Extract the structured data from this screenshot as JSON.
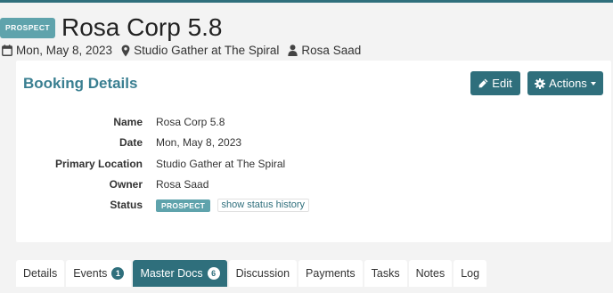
{
  "header": {
    "status_badge": "PROSPECT",
    "title": "Rosa Corp 5.8"
  },
  "meta": {
    "date": "Mon, May 8, 2023",
    "location": "Studio Gather at The Spiral",
    "owner": "Rosa Saad"
  },
  "card": {
    "title": "Booking Details",
    "edit_label": "Edit",
    "actions_label": "Actions"
  },
  "details": [
    {
      "label": "Name",
      "value": "Rosa Corp 5.8"
    },
    {
      "label": "Date",
      "value": "Mon, May 8, 2023"
    },
    {
      "label": "Primary Location",
      "value": "Studio Gather at The Spiral"
    },
    {
      "label": "Owner",
      "value": "Rosa Saad"
    }
  ],
  "status": {
    "label": "Status",
    "badge": "PROSPECT",
    "history_link": "show status history"
  },
  "tabs": [
    {
      "label": "Details"
    },
    {
      "label": "Events",
      "count": "1"
    },
    {
      "label": "Master Docs",
      "count": "6"
    },
    {
      "label": "Discussion"
    },
    {
      "label": "Payments"
    },
    {
      "label": "Tasks"
    },
    {
      "label": "Notes"
    },
    {
      "label": "Log"
    }
  ],
  "active_tab": "Master Docs",
  "colors": {
    "accent": "#2f6f7c",
    "badge": "#5fa3ac",
    "title": "#3a7f91",
    "background": "#f3f3f3"
  },
  "icons": {
    "date": "calendar-icon",
    "location": "map-marker-icon",
    "owner": "user-icon",
    "edit": "pencil-icon",
    "actions": "gear-icon"
  }
}
